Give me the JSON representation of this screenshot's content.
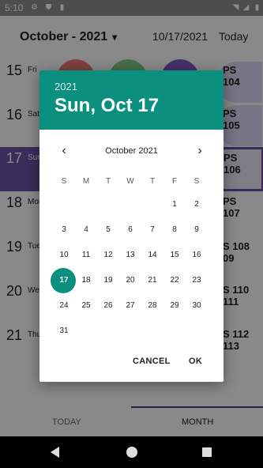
{
  "status_bar": {
    "time": "5:10"
  },
  "app": {
    "month_selector": "October - 2021",
    "current_date": "10/17/2021",
    "today_button": "Today",
    "rows": [
      {
        "num": "15",
        "dow": "Fri",
        "event": "PS\n104"
      },
      {
        "num": "16",
        "dow": "Sat",
        "event": "PS\n105"
      },
      {
        "num": "17",
        "dow": "Sun",
        "event": "PS\n106"
      },
      {
        "num": "18",
        "dow": "Mon",
        "event": "PS\n107"
      },
      {
        "num": "19",
        "dow": "Tue",
        "event": "S 108\n09"
      },
      {
        "num": "20",
        "dow": "Wed",
        "event": "S 110\n111"
      },
      {
        "num": "21",
        "dow": "Thu",
        "event": "S 112\n113"
      }
    ],
    "tabs": {
      "today": "TODAY",
      "month": "MONTH"
    }
  },
  "dialog": {
    "year": "2021",
    "selected_date": "Sun, Oct 17",
    "calendar_title": "October 2021",
    "weekdays": [
      "S",
      "M",
      "T",
      "W",
      "T",
      "F",
      "S"
    ],
    "weeks": [
      [
        "",
        "",
        "",
        "",
        "",
        "1",
        "2"
      ],
      [
        "3",
        "4",
        "5",
        "6",
        "7",
        "8",
        "9"
      ],
      [
        "10",
        "11",
        "12",
        "13",
        "14",
        "15",
        "16"
      ],
      [
        "17",
        "18",
        "19",
        "20",
        "21",
        "22",
        "23"
      ],
      [
        "24",
        "25",
        "26",
        "27",
        "28",
        "29",
        "30"
      ],
      [
        "31",
        "",
        "",
        "",
        "",
        "",
        ""
      ]
    ],
    "selected_day": "17",
    "cancel": "CANCEL",
    "ok": "OK"
  },
  "colors": {
    "accent": "#0b8f7f",
    "selected_row": "#6a52a8"
  }
}
